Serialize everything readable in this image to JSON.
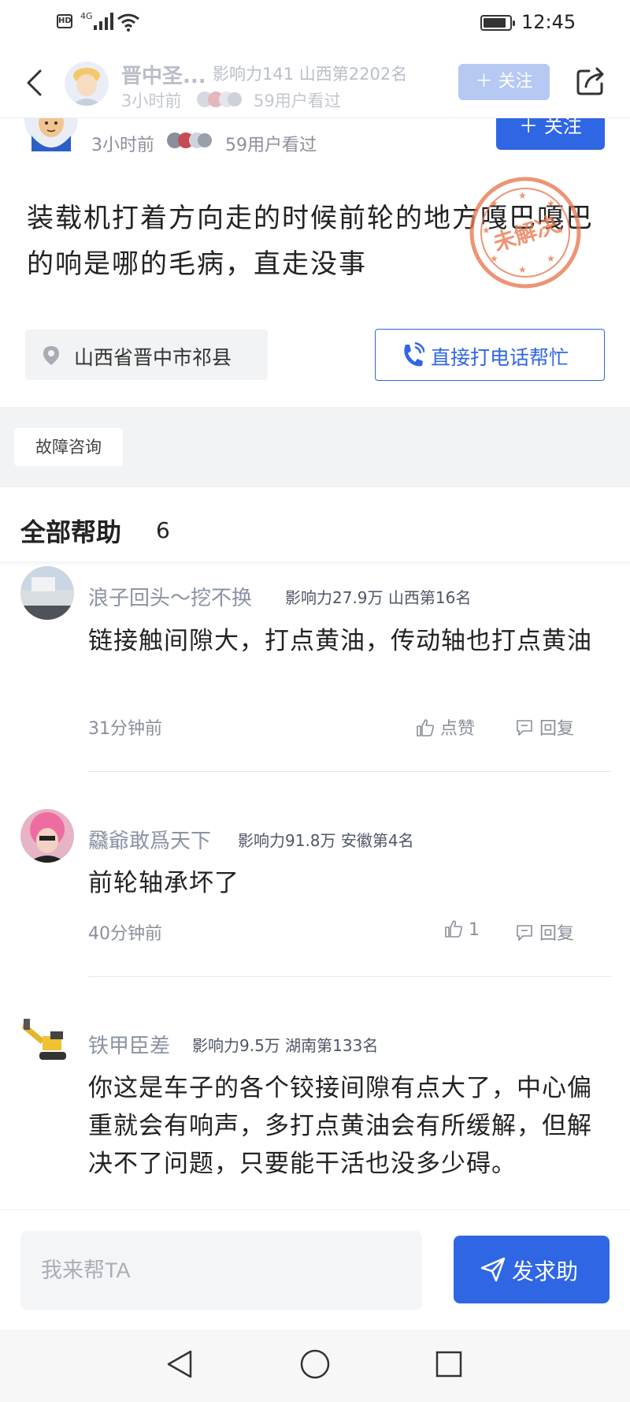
{
  "status_bar": {
    "hd": "HD",
    "network": "4G",
    "time": "12:45"
  },
  "header": {
    "name": "晋中圣...",
    "influence": "影响力141 山西第2202名",
    "time": "3小时前",
    "views": "59用户看过",
    "follow_label": "关注"
  },
  "post": {
    "time": "3小时前",
    "views": "59用户看过",
    "follow_label": "关注",
    "question": " 装载机打着方向走的时候前轮的地方嘎巴嘎巴的响是哪的毛病，直走没事",
    "stamp_text": "未解决",
    "location": "山西省晋中市祁县",
    "call_label": "直接打电话帮忙",
    "tag": "故障咨询"
  },
  "answers_section": {
    "title": "全部帮助",
    "count": "6"
  },
  "answers": [
    {
      "name": "浪子回头～挖不换",
      "meta": "影响力27.9万 山西第16名",
      "text": " 链接触间隙大，打点黄油，传动轴也打点黄油",
      "time": "31分钟前",
      "like_label": "点赞",
      "reply_label": "回复"
    },
    {
      "name": "飝爺敢爲天下",
      "meta": "影响力91.8万 安徽第4名",
      "text": " 前轮轴承坏了",
      "time": "40分钟前",
      "like_label": "1",
      "reply_label": "回复"
    },
    {
      "name": "铁甲臣差",
      "meta": "影响力9.5万 湖南第133名",
      "text": " 你这是车子的各个铰接间隙有点大了，中心偏重就会有响声，多打点黄油会有所缓解，但解决不了问题，只要能干活也没多少碍。"
    }
  ],
  "bottom_bar": {
    "input_placeholder": "我来帮TA",
    "send_label": "发求助"
  },
  "colors": {
    "primary": "#2f66e4",
    "stamp": "#e8774f",
    "follow_faded": "#b6c9f3"
  },
  "icons": [
    "back-icon",
    "share-icon",
    "location-pin-icon",
    "phone-icon",
    "thumb-up-icon",
    "comment-icon",
    "send-icon",
    "nav-back-icon",
    "nav-home-icon",
    "nav-recents-icon"
  ]
}
